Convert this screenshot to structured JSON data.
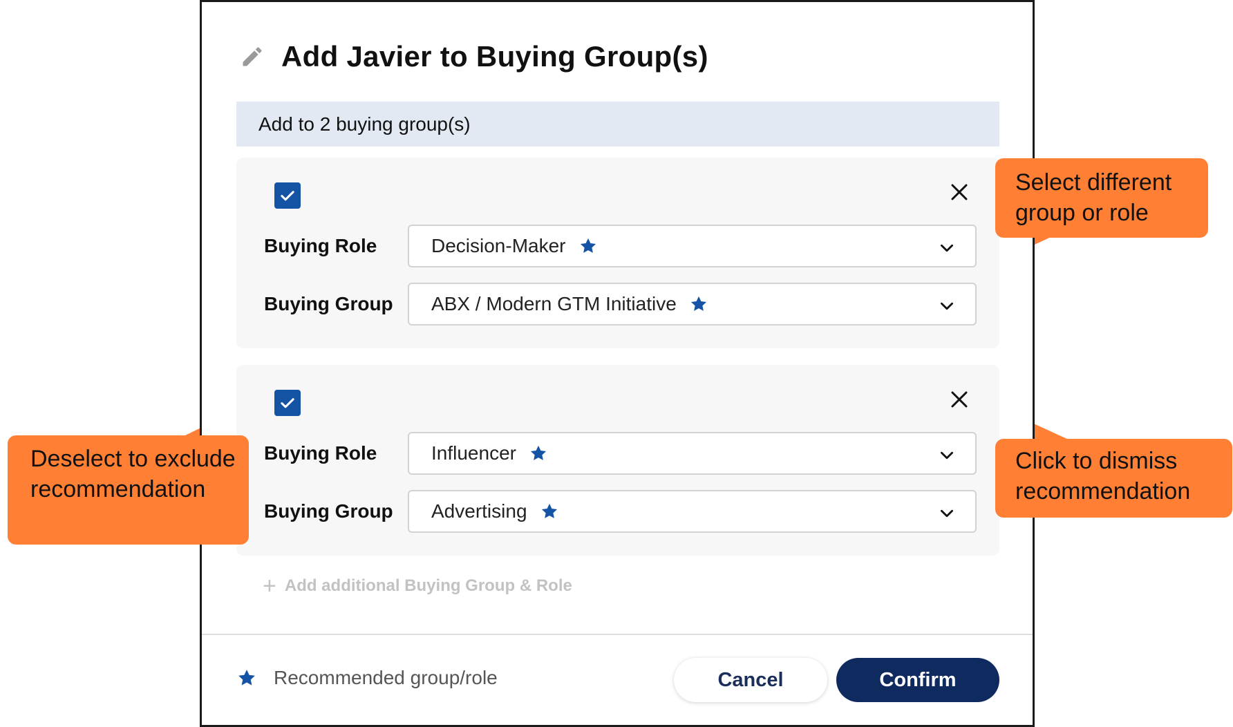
{
  "modal": {
    "title": "Add Javier to Buying Group(s)",
    "banner": "Add to 2 buying group(s)",
    "rows": [
      {
        "checked": true,
        "role_label": "Buying Role",
        "role_value": "Decision-Maker",
        "group_label": "Buying Group",
        "group_value": "ABX / Modern GTM Initiative"
      },
      {
        "checked": true,
        "role_label": "Buying Role",
        "role_value": "Influencer",
        "group_label": "Buying Group",
        "group_value": "Advertising"
      }
    ],
    "add_more_label": "Add additional Buying Group & Role",
    "legend_label": "Recommended group/role",
    "cancel_label": "Cancel",
    "confirm_label": "Confirm"
  },
  "callouts": {
    "select": "Select different group or role",
    "deselect": "Deselect to exclude recommendation",
    "dismiss": "Click to dismiss recommendation"
  },
  "colors": {
    "accent": "#1553a4",
    "primary_button": "#0f2a5e",
    "banner_bg": "#e3e9f2",
    "callout": "#ff7f35"
  },
  "icons": [
    "pencil-icon",
    "checkbox-checked-icon",
    "close-icon",
    "star-icon",
    "chevron-down-icon",
    "plus-icon"
  ]
}
